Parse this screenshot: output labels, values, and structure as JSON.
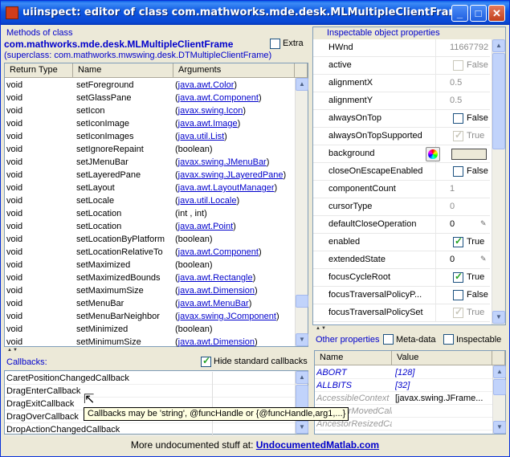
{
  "window": {
    "title": "uiinspect: editor of class com.mathworks.mde.desk.MLMultipleClientFrame",
    "minimize": "_",
    "maximize": "□",
    "close": "✕"
  },
  "methods": {
    "label": "Methods of class",
    "class_name": "com.mathworks.mde.desk.MLMultipleClientFrame",
    "superclass": "(superclass: com.mathworks.mwswing.desk.DTMultipleClientFrame)",
    "extra_label": "Extra",
    "extra_checked": false,
    "columns": [
      "Return Type",
      "Name",
      "Arguments"
    ],
    "rows": [
      {
        "ret": "void",
        "name": "setForeground",
        "pre": "(",
        "link": "java.awt.Color",
        "post": ")"
      },
      {
        "ret": "void",
        "name": "setGlassPane",
        "pre": "(",
        "link": "java.awt.Component",
        "post": ")"
      },
      {
        "ret": "void",
        "name": "setIcon",
        "pre": "(",
        "link": "javax.swing.Icon",
        "post": ")"
      },
      {
        "ret": "void",
        "name": "setIconImage",
        "pre": "(",
        "link": "java.awt.Image",
        "post": ")"
      },
      {
        "ret": "void",
        "name": "setIconImages",
        "pre": "(",
        "link": "java.util.List",
        "post": ")"
      },
      {
        "ret": "void",
        "name": "setIgnoreRepaint",
        "pre": "(boolean)",
        "link": "",
        "post": ""
      },
      {
        "ret": "void",
        "name": "setJMenuBar",
        "pre": "(",
        "link": "javax.swing.JMenuBar",
        "post": ")"
      },
      {
        "ret": "void",
        "name": "setLayeredPane",
        "pre": "(",
        "link": "javax.swing.JLayeredPane",
        "post": ")"
      },
      {
        "ret": "void",
        "name": "setLayout",
        "pre": "(",
        "link": "java.awt.LayoutManager",
        "post": ")"
      },
      {
        "ret": "void",
        "name": "setLocale",
        "pre": "(",
        "link": "java.util.Locale",
        "post": ")"
      },
      {
        "ret": "void",
        "name": "setLocation",
        "pre": "(int , int)",
        "link": "",
        "post": ""
      },
      {
        "ret": "void",
        "name": "setLocation",
        "pre": "(",
        "link": "java.awt.Point",
        "post": ")"
      },
      {
        "ret": "void",
        "name": "setLocationByPlatform",
        "pre": "(boolean)",
        "link": "",
        "post": ""
      },
      {
        "ret": "void",
        "name": "setLocationRelativeTo",
        "pre": "(",
        "link": "java.awt.Component",
        "post": ")"
      },
      {
        "ret": "void",
        "name": "setMaximized",
        "pre": "(boolean)",
        "link": "",
        "post": ""
      },
      {
        "ret": "void",
        "name": "setMaximizedBounds",
        "pre": "(",
        "link": "java.awt.Rectangle",
        "post": ")"
      },
      {
        "ret": "void",
        "name": "setMaximumSize",
        "pre": "(",
        "link": "java.awt.Dimension",
        "post": ")"
      },
      {
        "ret": "void",
        "name": "setMenuBar",
        "pre": "(",
        "link": "java.awt.MenuBar",
        "post": ")"
      },
      {
        "ret": "void",
        "name": "setMenuBarNeighbor",
        "pre": "(",
        "link": "javax.swing.JComponent",
        "post": ")"
      },
      {
        "ret": "void",
        "name": "setMinimized",
        "pre": "(boolean)",
        "link": "",
        "post": ""
      },
      {
        "ret": "void",
        "name": "setMinimumSize",
        "pre": "(",
        "link": "java.awt.Dimension",
        "post": ")"
      }
    ]
  },
  "callbacks": {
    "label": "Callbacks:",
    "hide_label": "Hide standard callbacks",
    "hide_checked": true,
    "rows": [
      "CaretPositionChangedCallback",
      "DragEnterCallback",
      "DragExitCallback",
      "DragOverCallback",
      "DropActionChangedCallback"
    ],
    "tooltip": "Callbacks may be 'string', @funcHandle or {@funcHandle,arg1,...}"
  },
  "props": {
    "label": "Inspectable object properties",
    "rows": [
      {
        "name": "HWnd",
        "kind": "text",
        "value": "11667792",
        "gray": true
      },
      {
        "name": "active",
        "kind": "check",
        "checked": false,
        "disabled": true,
        "value": "False"
      },
      {
        "name": "alignmentX",
        "kind": "text",
        "value": "0.5",
        "gray": true
      },
      {
        "name": "alignmentY",
        "kind": "text",
        "value": "0.5",
        "gray": true
      },
      {
        "name": "alwaysOnTop",
        "kind": "check",
        "checked": false,
        "disabled": false,
        "value": "False"
      },
      {
        "name": "alwaysOnTopSupported",
        "kind": "check",
        "checked": true,
        "disabled": true,
        "value": "True"
      },
      {
        "name": "background",
        "kind": "color",
        "value": ""
      },
      {
        "name": "closeOnEscapeEnabled",
        "kind": "check",
        "checked": false,
        "disabled": false,
        "value": "False"
      },
      {
        "name": "componentCount",
        "kind": "text",
        "value": "1",
        "gray": true
      },
      {
        "name": "cursorType",
        "kind": "text",
        "value": "0",
        "gray": true
      },
      {
        "name": "defaultCloseOperation",
        "kind": "edit",
        "value": "0",
        "gray": false
      },
      {
        "name": "enabled",
        "kind": "check",
        "checked": true,
        "disabled": false,
        "value": "True"
      },
      {
        "name": "extendedState",
        "kind": "edit",
        "value": "0",
        "gray": false
      },
      {
        "name": "focusCycleRoot",
        "kind": "check",
        "checked": true,
        "disabled": false,
        "value": "True"
      },
      {
        "name": "focusTraversalPolicyP...",
        "kind": "check",
        "checked": false,
        "disabled": false,
        "value": "False"
      },
      {
        "name": "focusTraversalPolicySet",
        "kind": "check",
        "checked": true,
        "disabled": true,
        "value": "True"
      }
    ],
    "background_color": "#ece9d8"
  },
  "other": {
    "label": "Other properties",
    "metadata_label": "Meta-data",
    "inspectable_label": "Inspectable",
    "columns": [
      "Name",
      "Value"
    ],
    "rows": [
      {
        "name": "ABORT",
        "value": "[128]",
        "style": "blue"
      },
      {
        "name": "ALLBITS",
        "value": "[32]",
        "style": "blue"
      },
      {
        "name": "AccessibleContext",
        "value": "[javax.swing.JFrame...",
        "style": "gray"
      },
      {
        "name": "AncestorMovedCallback",
        "value": "",
        "style": "gray"
      },
      {
        "name": "AncestorResizedCallb...",
        "value": "",
        "style": "gray"
      }
    ]
  },
  "footer": {
    "text": "More undocumented stuff at: ",
    "link": "UndocumentedMatlab.com"
  },
  "colors": {
    "title_blue": "#0a48d4",
    "link_blue": "#0000cc",
    "face": "#ece9d8"
  }
}
